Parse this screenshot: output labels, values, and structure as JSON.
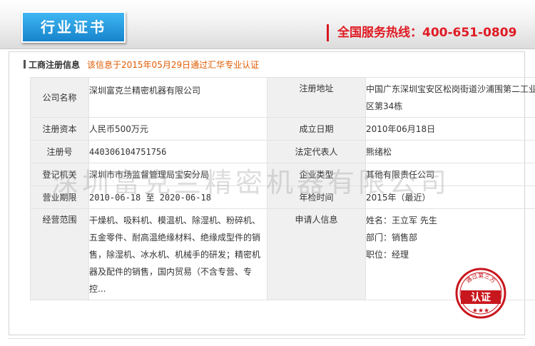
{
  "header": {
    "tab_label": "行业证书",
    "hotline": "全国服务热线：400-651-0809"
  },
  "section": {
    "title": "工商注册信息",
    "cert_note": "该信息于2015年05月29日通过汇华专业认证"
  },
  "company": {
    "company_name_label": "公司名称",
    "company_name": "深圳富克兰精密机器有限公司",
    "reg_address_label": "注册地址",
    "reg_address": "中国广东深圳宝安区松岗街道沙浦围第二工业区第34栋",
    "reg_capital_label": "注册资本",
    "reg_capital": "人民币500万元",
    "founded_label": "成立日期",
    "founded": "2010年06月18日",
    "reg_no_label": "注册号",
    "reg_no": "440306104751756",
    "legal_rep_label": "法定代表人",
    "legal_rep": "熊绪松",
    "authority_label": "登记机关",
    "authority": "深圳市市场监督管理局宝安分局",
    "company_type_label": "企业类型",
    "company_type": "其他有限责任公司",
    "term_label": "营业期限",
    "term": "2010-06-18 至 2020-06-18",
    "inspection_label": "年检时间",
    "inspection": "2015年（最近）",
    "scope_label": "经营范围",
    "scope": "干燥机、吸料机、模温机、除湿机、粉碎机、五金零件、耐高温绝缘材料、绝缘成型件的销售，除湿机、冰水机、机械手的研发；精密机器及配件的销售，国内贸易（不含专营、专控...",
    "applicant_label": "申请人信息",
    "applicant_name": "姓名：王立军 先生",
    "applicant_dept": "部门：销售部",
    "applicant_title": "职位：经理"
  },
  "watermark": "深圳富克兰精密机器有限公司",
  "stamp": {
    "top_text": "通过第三方",
    "main_text": "认证"
  }
}
